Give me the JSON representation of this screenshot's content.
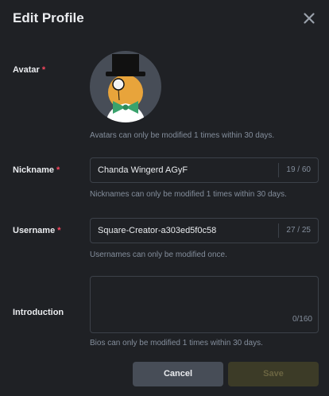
{
  "dialog": {
    "title": "Edit Profile"
  },
  "avatar": {
    "label": "Avatar",
    "required_mark": "*",
    "hint": "Avatars can only be modified 1 times within 30 days.",
    "icon": "top-hat-gentleman-avatar"
  },
  "nickname": {
    "label": "Nickname",
    "required_mark": "*",
    "value": "Chanda Wingerd AGyF",
    "counter": "19 / 60",
    "hint": "Nicknames can only be modified 1 times within 30 days."
  },
  "username": {
    "label": "Username",
    "required_mark": "*",
    "value": "Square-Creator-a303ed5f0c58",
    "counter": "27 / 25",
    "hint": "Usernames can only be modified once."
  },
  "introduction": {
    "label": "Introduction",
    "value": "",
    "counter": "0/160",
    "hint": "Bios can only be modified 1 times within 30 days."
  },
  "actions": {
    "cancel_label": "Cancel",
    "save_label": "Save"
  },
  "colors": {
    "background": "#1f2125",
    "required": "#f6465d",
    "field_border": "#3c4149",
    "hint_text": "#848e9c",
    "cancel_bg": "#474d57",
    "save_bg_disabled": "#3c3b27"
  }
}
